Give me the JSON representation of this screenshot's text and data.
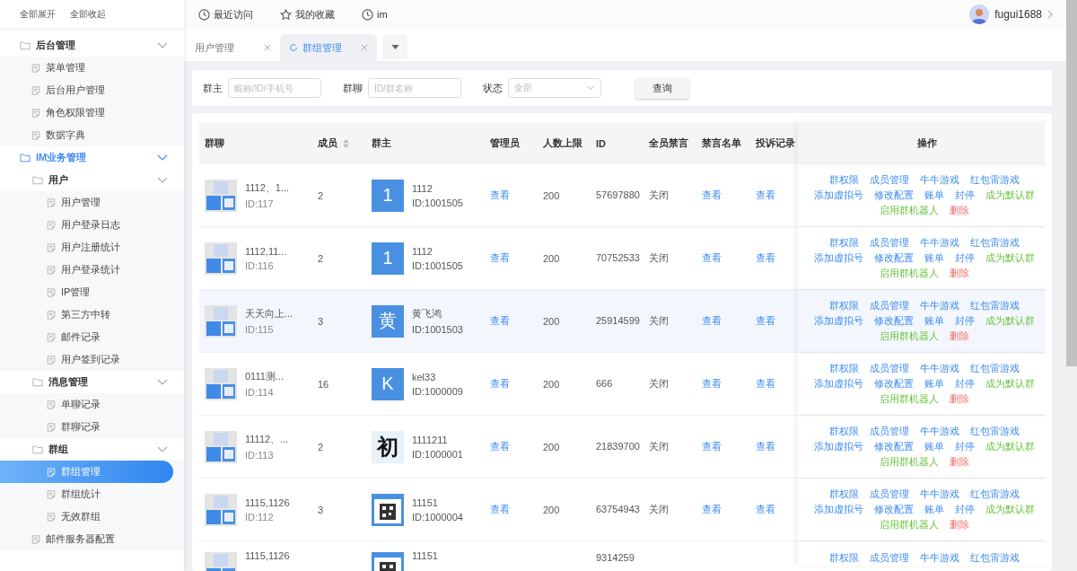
{
  "sidebar": {
    "actions": [
      "全部展开",
      "全部收起"
    ],
    "items": [
      {
        "label": "后台管理",
        "kind": "folder",
        "expanded": true,
        "active": false,
        "children": [
          {
            "label": "菜单管理",
            "kind": "page",
            "selected": false
          },
          {
            "label": "后台用户管理",
            "kind": "page",
            "selected": false
          },
          {
            "label": "角色权限管理",
            "kind": "page",
            "selected": false
          },
          {
            "label": "数据字典",
            "kind": "page",
            "selected": false
          }
        ]
      },
      {
        "label": "IM业务管理",
        "kind": "folder",
        "expanded": true,
        "active": true,
        "children": [
          {
            "label": "用户",
            "kind": "folder",
            "expanded": true,
            "active": false,
            "children": [
              {
                "label": "用户管理",
                "kind": "page",
                "selected": false
              },
              {
                "label": "用户登录日志",
                "kind": "page",
                "selected": false
              },
              {
                "label": "用户注册统计",
                "kind": "page",
                "selected": false
              },
              {
                "label": "用户登录统计",
                "kind": "page",
                "selected": false
              },
              {
                "label": "IP管理",
                "kind": "page",
                "selected": false
              },
              {
                "label": "第三方中转",
                "kind": "page",
                "selected": false
              },
              {
                "label": "邮件记录",
                "kind": "page",
                "selected": false
              },
              {
                "label": "用户签到记录",
                "kind": "page",
                "selected": false
              }
            ]
          },
          {
            "label": "消息管理",
            "kind": "folder",
            "expanded": true,
            "active": false,
            "children": [
              {
                "label": "单聊记录",
                "kind": "page",
                "selected": false
              },
              {
                "label": "群聊记录",
                "kind": "page",
                "selected": false
              }
            ]
          },
          {
            "label": "群组",
            "kind": "folder",
            "expanded": true,
            "active": false,
            "children": [
              {
                "label": "群组管理",
                "kind": "page",
                "selected": true
              },
              {
                "label": "群组统计",
                "kind": "page",
                "selected": false
              },
              {
                "label": "无效群组",
                "kind": "page",
                "selected": false
              }
            ]
          },
          {
            "label": "邮件服务器配置",
            "kind": "page",
            "selected": false
          }
        ]
      }
    ]
  },
  "topbar": {
    "links": [
      {
        "label": "最近访问"
      },
      {
        "label": "我的收藏"
      },
      {
        "label": "im"
      }
    ],
    "user": "fugui1688"
  },
  "tabs": [
    {
      "label": "用户管理",
      "selected": false
    },
    {
      "label": "群组管理",
      "selected": true
    }
  ],
  "filters": {
    "fields": [
      {
        "label": "群主",
        "placeholder": "昵称/ID/手机号",
        "kind": "input"
      },
      {
        "label": "群聊",
        "placeholder": "ID/群名称",
        "kind": "input"
      },
      {
        "label": "状态",
        "placeholder": "全部",
        "kind": "select"
      }
    ],
    "button": "查询"
  },
  "table": {
    "columns": [
      "群聊",
      "成员",
      "群主",
      "管理员",
      "人数上限",
      "ID",
      "全员禁言",
      "禁言名单",
      "投诉记录",
      "操作"
    ],
    "rows": [
      {
        "highlighted": false,
        "group_name": "1112、1...",
        "group_id": "ID:117",
        "members": "2",
        "owner_avatar": {
          "kind": "letter",
          "text": "1"
        },
        "owner_name": "1112",
        "owner_id": "ID:1001505",
        "admins": "查看",
        "limit": "200",
        "id": "57697880",
        "mute_all": "关闭",
        "mute_list": "查看",
        "complaints": "查看",
        "actions": [
          {
            "label": "群权限",
            "kind": "link"
          },
          {
            "label": "成员管理",
            "kind": "link"
          },
          {
            "label": "牛牛游戏",
            "kind": "link"
          },
          {
            "label": "红包雷游戏",
            "kind": "link"
          },
          {
            "label": "添加虚拟号",
            "kind": "link"
          },
          {
            "label": "修改配置",
            "kind": "link"
          },
          {
            "label": "账单",
            "kind": "link"
          },
          {
            "label": "封停",
            "kind": "link"
          },
          {
            "label": "成为默认群",
            "kind": "success"
          },
          {
            "label": "启用群机器人",
            "kind": "success"
          },
          {
            "label": "删除",
            "kind": "danger"
          }
        ]
      },
      {
        "highlighted": false,
        "group_name": "1112,11...",
        "group_id": "ID:116",
        "members": "2",
        "owner_avatar": {
          "kind": "letter",
          "text": "1"
        },
        "owner_name": "1112",
        "owner_id": "ID:1001505",
        "admins": "查看",
        "limit": "200",
        "id": "70752533",
        "mute_all": "关闭",
        "mute_list": "查看",
        "complaints": "查看",
        "actions": [
          {
            "label": "群权限",
            "kind": "link"
          },
          {
            "label": "成员管理",
            "kind": "link"
          },
          {
            "label": "牛牛游戏",
            "kind": "link"
          },
          {
            "label": "红包雷游戏",
            "kind": "link"
          },
          {
            "label": "添加虚拟号",
            "kind": "link"
          },
          {
            "label": "修改配置",
            "kind": "link"
          },
          {
            "label": "账单",
            "kind": "link"
          },
          {
            "label": "封停",
            "kind": "link"
          },
          {
            "label": "成为默认群",
            "kind": "success"
          },
          {
            "label": "启用群机器人",
            "kind": "success"
          },
          {
            "label": "删除",
            "kind": "danger"
          }
        ]
      },
      {
        "highlighted": true,
        "group_name": "天天向上...",
        "group_id": "ID:115",
        "members": "3",
        "owner_avatar": {
          "kind": "letter",
          "text": "黄"
        },
        "owner_name": "黄飞鸿",
        "owner_id": "ID:1001503",
        "admins": "查看",
        "limit": "200",
        "id": "25914599",
        "mute_all": "关闭",
        "mute_list": "查看",
        "complaints": "查看",
        "actions": [
          {
            "label": "群权限",
            "kind": "link"
          },
          {
            "label": "成员管理",
            "kind": "link"
          },
          {
            "label": "牛牛游戏",
            "kind": "link"
          },
          {
            "label": "红包雷游戏",
            "kind": "link"
          },
          {
            "label": "添加虚拟号",
            "kind": "link"
          },
          {
            "label": "修改配置",
            "kind": "link"
          },
          {
            "label": "账单",
            "kind": "link"
          },
          {
            "label": "封停",
            "kind": "link"
          },
          {
            "label": "成为默认群",
            "kind": "success"
          },
          {
            "label": "启用群机器人",
            "kind": "success"
          },
          {
            "label": "删除",
            "kind": "danger"
          }
        ]
      },
      {
        "highlighted": false,
        "group_name": "0111测...",
        "group_id": "ID:114",
        "members": "16",
        "owner_avatar": {
          "kind": "letter",
          "text": "K"
        },
        "owner_name": "kel33",
        "owner_id": "ID:1000009",
        "admins": "查看",
        "limit": "200",
        "id": "666",
        "mute_all": "关闭",
        "mute_list": "查看",
        "complaints": "查看",
        "actions": [
          {
            "label": "群权限",
            "kind": "link"
          },
          {
            "label": "成员管理",
            "kind": "link"
          },
          {
            "label": "牛牛游戏",
            "kind": "link"
          },
          {
            "label": "红包雷游戏",
            "kind": "link"
          },
          {
            "label": "添加虚拟号",
            "kind": "link"
          },
          {
            "label": "修改配置",
            "kind": "link"
          },
          {
            "label": "账单",
            "kind": "link"
          },
          {
            "label": "封停",
            "kind": "link"
          },
          {
            "label": "成为默认群",
            "kind": "success"
          },
          {
            "label": "启用群机器人",
            "kind": "success"
          },
          {
            "label": "删除",
            "kind": "danger"
          }
        ]
      },
      {
        "highlighted": false,
        "group_name": "11112、...",
        "group_id": "ID:113",
        "members": "2",
        "owner_avatar": {
          "kind": "glyph",
          "text": "初"
        },
        "owner_name": "1111211",
        "owner_id": "ID:1000001",
        "admins": "查看",
        "limit": "200",
        "id": "21839700",
        "mute_all": "关闭",
        "mute_list": "查看",
        "complaints": "查看",
        "actions": [
          {
            "label": "群权限",
            "kind": "link"
          },
          {
            "label": "成员管理",
            "kind": "link"
          },
          {
            "label": "牛牛游戏",
            "kind": "link"
          },
          {
            "label": "红包雷游戏",
            "kind": "link"
          },
          {
            "label": "添加虚拟号",
            "kind": "link"
          },
          {
            "label": "修改配置",
            "kind": "link"
          },
          {
            "label": "账单",
            "kind": "link"
          },
          {
            "label": "封停",
            "kind": "link"
          },
          {
            "label": "成为默认群",
            "kind": "success"
          },
          {
            "label": "启用群机器人",
            "kind": "success"
          },
          {
            "label": "删除",
            "kind": "danger"
          }
        ]
      },
      {
        "highlighted": false,
        "group_name": "1115,1126",
        "group_id": "ID:112",
        "members": "3",
        "owner_avatar": {
          "kind": "qr"
        },
        "owner_name": "11151",
        "owner_id": "ID:1000004",
        "admins": "查看",
        "limit": "200",
        "id": "63754943",
        "mute_all": "关闭",
        "mute_list": "查看",
        "complaints": "查看",
        "actions": [
          {
            "label": "群权限",
            "kind": "link"
          },
          {
            "label": "成员管理",
            "kind": "link"
          },
          {
            "label": "牛牛游戏",
            "kind": "link"
          },
          {
            "label": "红包雷游戏",
            "kind": "link"
          },
          {
            "label": "添加虚拟号",
            "kind": "link"
          },
          {
            "label": "修改配置",
            "kind": "link"
          },
          {
            "label": "账单",
            "kind": "link"
          },
          {
            "label": "封停",
            "kind": "link"
          },
          {
            "label": "成为默认群",
            "kind": "success"
          },
          {
            "label": "启用群机器人",
            "kind": "success"
          },
          {
            "label": "删除",
            "kind": "danger"
          }
        ]
      },
      {
        "highlighted": false,
        "group_name": "1115,1126",
        "owner_avatar": {
          "kind": "qr"
        },
        "owner_name": "11151",
        "id": "9314259",
        "actions": [
          {
            "label": "群权限",
            "kind": "link"
          },
          {
            "label": "成员管理",
            "kind": "link"
          },
          {
            "label": "牛牛游戏",
            "kind": "link"
          },
          {
            "label": "红包雷游戏",
            "kind": "link"
          }
        ]
      }
    ]
  }
}
